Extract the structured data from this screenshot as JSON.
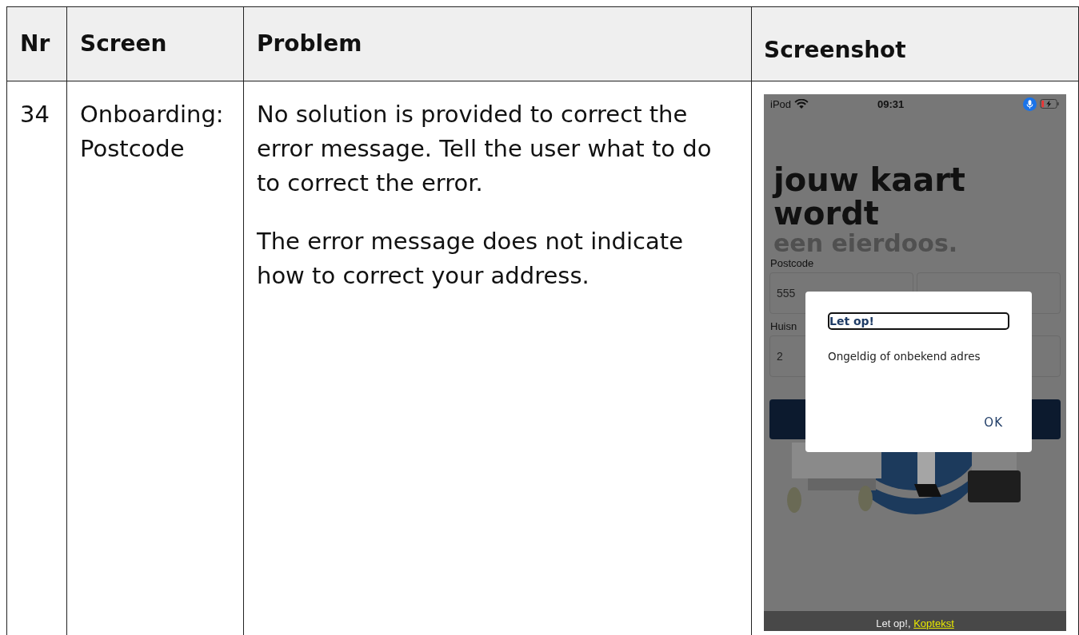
{
  "table": {
    "columns": [
      "Nr",
      "Screen",
      "Problem",
      "Screenshot"
    ],
    "rows": [
      {
        "nr": "34",
        "screen": "Onboarding: Postcode",
        "problem": [
          "No solution is provided to correct the error message. Tell the user what to do to correct the error.",
          "The error message does not indicate how to correct your address."
        ],
        "screenshot": {
          "status_bar": {
            "device": "iPod",
            "time": "09:31"
          },
          "heading": [
            "jouw kaart",
            "wordt"
          ],
          "heading_faded": "een eierdoos.",
          "postcode_label": "Postcode",
          "postcode_value": "555",
          "house_label": "Huisn",
          "house_value": "2",
          "dialog": {
            "title": "Let op!",
            "message": "Ongeldig of onbekend adres",
            "button": "OK"
          },
          "caption": {
            "text": "Let op!,",
            "link": "Koptekst"
          }
        }
      }
    ]
  }
}
